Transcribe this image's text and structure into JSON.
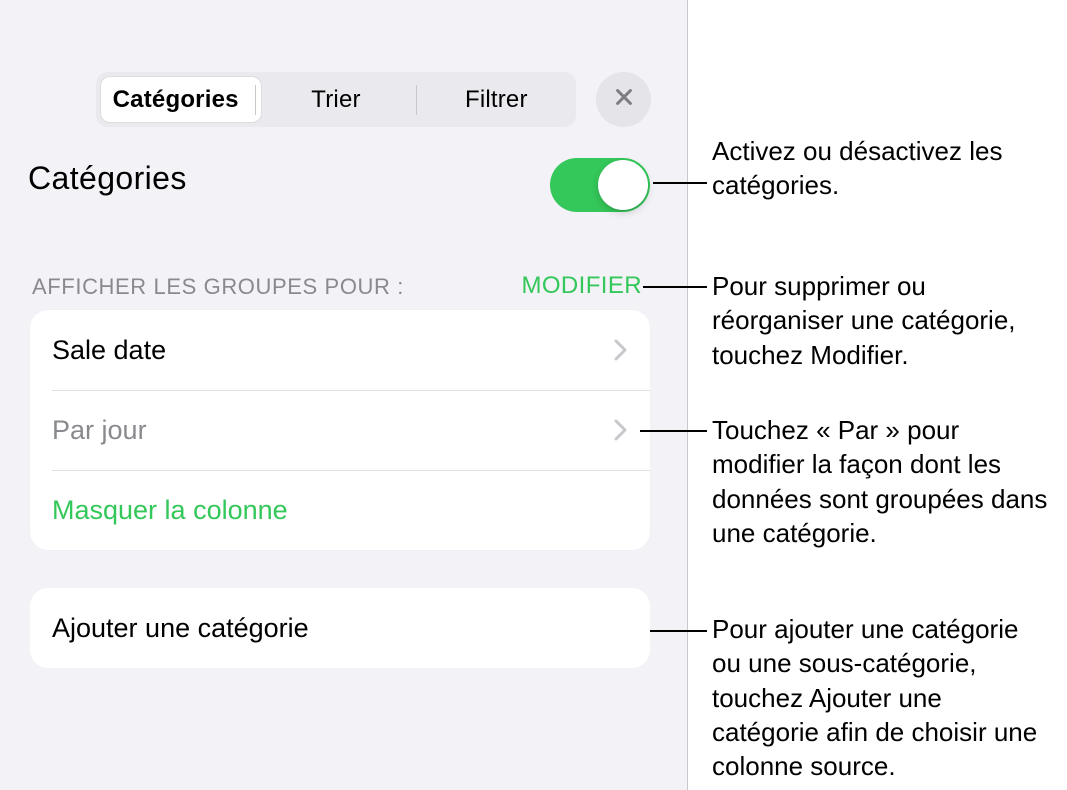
{
  "tabs": {
    "categories": "Catégories",
    "sort": "Trier",
    "filter": "Filtrer"
  },
  "title": "Catégories",
  "section_label": "AFFICHER LES GROUPES POUR :",
  "modify": "MODIFIER",
  "rows": {
    "sale_date": "Sale date",
    "per_prefix": "Par",
    "per_unit": "jour",
    "hide_col": "Masquer la colonne"
  },
  "add_category": "Ajouter une catégorie",
  "callouts": {
    "toggle": "Activez ou désactivez les catégories.",
    "modify": "Pour supprimer ou réorganiser une catégorie, touchez Modifier.",
    "per": "Touchez « Par » pour modifier la façon dont les données sont groupées dans une catégorie.",
    "add": "Pour ajouter une catégorie ou une sous-catégorie, touchez Ajouter une catégorie afin de choisir une colonne source."
  }
}
